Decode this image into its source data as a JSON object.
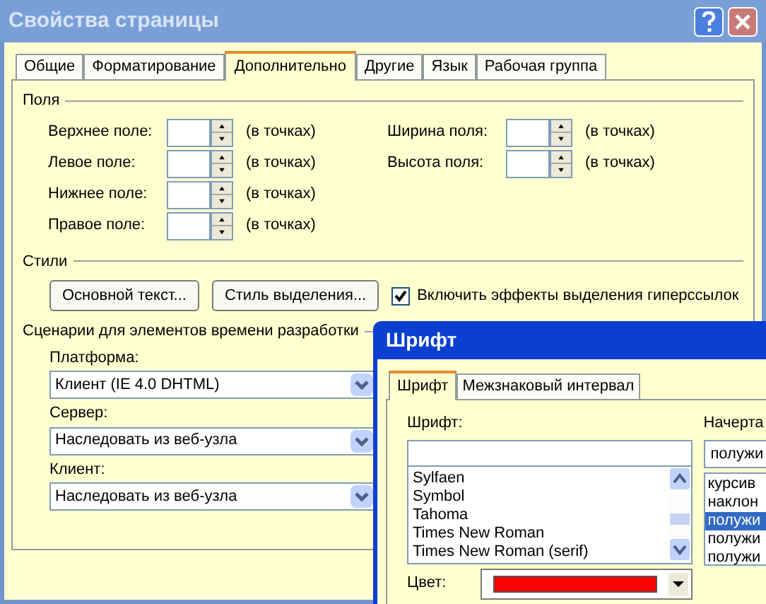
{
  "window": {
    "title": "Свойства страницы"
  },
  "tabs": [
    {
      "label": "Общие",
      "selected": false
    },
    {
      "label": "Форматирование",
      "selected": false
    },
    {
      "label": "Дополнительно",
      "selected": true
    },
    {
      "label": "Другие",
      "selected": false
    },
    {
      "label": "Язык",
      "selected": false
    },
    {
      "label": "Рабочая группа",
      "selected": false
    }
  ],
  "margins": {
    "title": "Поля",
    "left_fields": [
      {
        "label": "Верхнее поле:",
        "unit": "(в точках)"
      },
      {
        "label": "Левое поле:",
        "unit": "(в точках)"
      },
      {
        "label": "Нижнее поле:",
        "unit": "(в точках)"
      },
      {
        "label": "Правое поле:",
        "unit": "(в точках)"
      }
    ],
    "right_fields": [
      {
        "label": "Ширина поля:",
        "unit": "(в точках)"
      },
      {
        "label": "Высота поля:",
        "unit": "(в точках)"
      }
    ]
  },
  "styles": {
    "title": "Стили",
    "buttons": [
      "Основной текст...",
      "Стиль выделения..."
    ],
    "checkbox": {
      "label": "Включить эффекты выделения гиперссылок",
      "checked": true
    }
  },
  "scripts": {
    "title": "Сценарии для элементов времени разработки",
    "selects": [
      {
        "label": "Платформа:",
        "value": "Клиент (IE 4.0 DHTML)"
      },
      {
        "label": "Сервер:",
        "value": "Наследовать из веб-узла"
      },
      {
        "label": "Клиент:",
        "value": "Наследовать из веб-узла"
      }
    ]
  },
  "font_dialog": {
    "title": "Шрифт",
    "tabs": [
      {
        "label": "Шрифт",
        "selected": true
      },
      {
        "label": "Межзнаковый интервал",
        "selected": false
      }
    ],
    "font_label": "Шрифт:",
    "fonts": [
      {
        "label": "Sylfaen",
        "selected": false
      },
      {
        "label": "Symbol",
        "selected": false
      },
      {
        "label": "Tahoma",
        "selected": false
      },
      {
        "label": "Times New Roman",
        "selected": false
      },
      {
        "label": "Times New Roman (serif)",
        "selected": false
      }
    ],
    "color_label": "Цвет:",
    "color": "#ff0000",
    "style_label": "Начерта",
    "style_value": "полужи",
    "styles": [
      {
        "label": "курсив",
        "selected": false
      },
      {
        "label": "наклон",
        "selected": false
      },
      {
        "label": "полужи",
        "selected": true
      },
      {
        "label": "полужи",
        "selected": false
      },
      {
        "label": "полужи",
        "selected": false
      }
    ]
  }
}
